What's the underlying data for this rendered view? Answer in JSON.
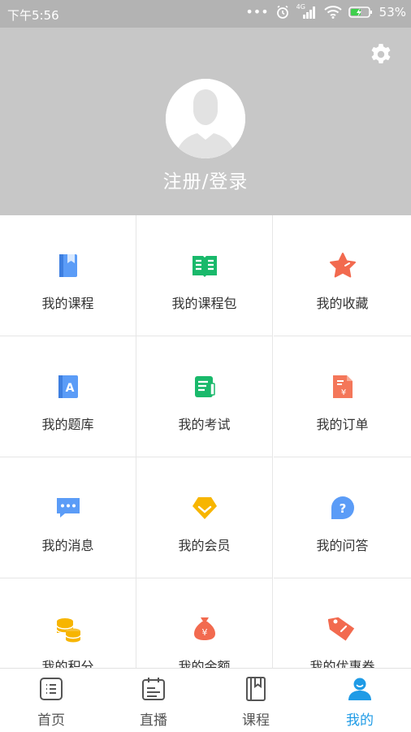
{
  "status_bar": {
    "time": "下午5:56",
    "battery": "53%",
    "network": "4G"
  },
  "header": {
    "login_text": "注册/登录"
  },
  "grid": {
    "items": [
      {
        "label": "我的课程"
      },
      {
        "label": "我的课程包"
      },
      {
        "label": "我的收藏"
      },
      {
        "label": "我的题库"
      },
      {
        "label": "我的考试"
      },
      {
        "label": "我的订单"
      },
      {
        "label": "我的消息"
      },
      {
        "label": "我的会员"
      },
      {
        "label": "我的问答"
      },
      {
        "label": "我的积分"
      },
      {
        "label": "我的余额"
      },
      {
        "label": "我的优惠券"
      }
    ]
  },
  "tabbar": {
    "tabs": [
      {
        "label": "首页"
      },
      {
        "label": "直播"
      },
      {
        "label": "课程"
      },
      {
        "label": "我的"
      }
    ],
    "active_color": "#1f9be6"
  }
}
